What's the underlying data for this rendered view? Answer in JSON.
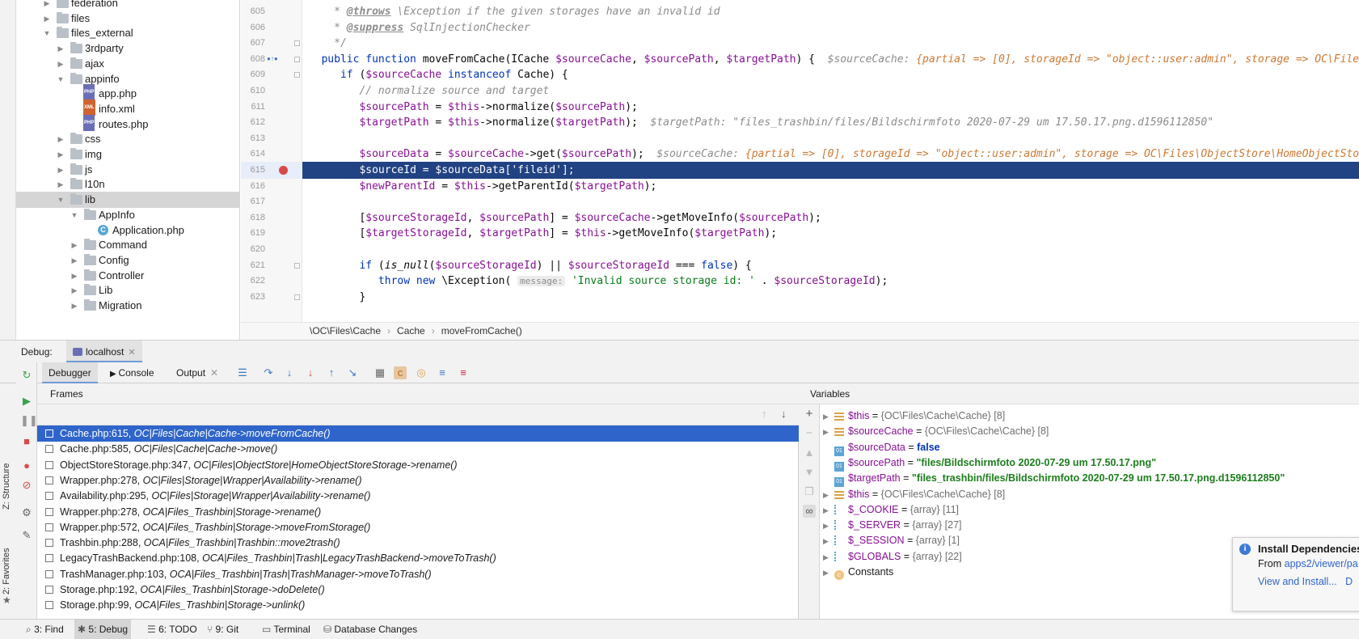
{
  "tree": {
    "items": [
      {
        "label": "federation",
        "type": "folder",
        "depth": 2,
        "expanded": false
      },
      {
        "label": "files",
        "type": "folder",
        "depth": 2,
        "expanded": false
      },
      {
        "label": "files_external",
        "type": "folder",
        "depth": 2,
        "expanded": true
      },
      {
        "label": "3rdparty",
        "type": "folder",
        "depth": 3,
        "expanded": false
      },
      {
        "label": "ajax",
        "type": "folder",
        "depth": 3,
        "expanded": false
      },
      {
        "label": "appinfo",
        "type": "folder",
        "depth": 3,
        "expanded": true
      },
      {
        "label": "app.php",
        "type": "php",
        "depth": 4
      },
      {
        "label": "info.xml",
        "type": "xml",
        "depth": 4
      },
      {
        "label": "routes.php",
        "type": "php",
        "depth": 4
      },
      {
        "label": "css",
        "type": "folder",
        "depth": 3,
        "expanded": false
      },
      {
        "label": "img",
        "type": "folder",
        "depth": 3,
        "expanded": false
      },
      {
        "label": "js",
        "type": "folder",
        "depth": 3,
        "expanded": false
      },
      {
        "label": "l10n",
        "type": "folder",
        "depth": 3,
        "expanded": false
      },
      {
        "label": "lib",
        "type": "folder",
        "depth": 3,
        "expanded": true,
        "selected": true
      },
      {
        "label": "AppInfo",
        "type": "folder",
        "depth": 4,
        "expanded": true
      },
      {
        "label": "Application.php",
        "type": "class",
        "depth": 5
      },
      {
        "label": "Command",
        "type": "folder",
        "depth": 4,
        "expanded": false
      },
      {
        "label": "Config",
        "type": "folder",
        "depth": 4,
        "expanded": false
      },
      {
        "label": "Controller",
        "type": "folder",
        "depth": 4,
        "expanded": false
      },
      {
        "label": "Lib",
        "type": "folder",
        "depth": 4,
        "expanded": false
      },
      {
        "label": "Migration",
        "type": "folder",
        "depth": 4,
        "expanded": false
      }
    ]
  },
  "editor": {
    "line_numbers": [
      "605",
      "606",
      "607",
      "608",
      "609",
      "610",
      "611",
      "612",
      "613",
      "614",
      "615",
      "616",
      "617",
      "618",
      "619",
      "620",
      "621",
      "622",
      "623"
    ],
    "current_line": "615",
    "breadcrumb": [
      "\\OC\\Files\\Cache",
      "Cache",
      "moveFromCache()"
    ]
  },
  "debug": {
    "title": "Debug:",
    "session_tab": "localhost",
    "tabs": [
      "Debugger",
      "Console",
      "Output"
    ],
    "frames_title": "Frames",
    "variables_title": "Variables",
    "frames": [
      {
        "file": "Cache.php:615,",
        "method": "OC|Files|Cache|Cache->moveFromCache()"
      },
      {
        "file": "Cache.php:585,",
        "method": "OC|Files|Cache|Cache->move()"
      },
      {
        "file": "ObjectStoreStorage.php:347,",
        "method": "OC|Files|ObjectStore|HomeObjectStoreStorage->rename()"
      },
      {
        "file": "Wrapper.php:278,",
        "method": "OC|Files|Storage|Wrapper|Availability->rename()"
      },
      {
        "file": "Availability.php:295,",
        "method": "OC|Files|Storage|Wrapper|Availability->rename()"
      },
      {
        "file": "Wrapper.php:278,",
        "method": "OCA|Files_Trashbin|Storage->rename()"
      },
      {
        "file": "Wrapper.php:572,",
        "method": "OCA|Files_Trashbin|Storage->moveFromStorage()"
      },
      {
        "file": "Trashbin.php:288,",
        "method": "OCA|Files_Trashbin|Trashbin::move2trash()"
      },
      {
        "file": "LegacyTrashBackend.php:108,",
        "method": "OCA|Files_Trashbin|Trash|LegacyTrashBackend->moveToTrash()"
      },
      {
        "file": "TrashManager.php:103,",
        "method": "OCA|Files_Trashbin|Trash|TrashManager->moveToTrash()"
      },
      {
        "file": "Storage.php:192,",
        "method": "OCA|Files_Trashbin|Storage->doDelete()"
      },
      {
        "file": "Storage.php:99,",
        "method": "OCA|Files_Trashbin|Storage->unlink()"
      }
    ],
    "variables": [
      {
        "name": "$this",
        "eq": " = ",
        "value": "{OC\\Files\\Cache\\Cache} [8]",
        "kind": "obj",
        "expandable": true
      },
      {
        "name": "$sourceCache",
        "eq": " = ",
        "value": "{OC\\Files\\Cache\\Cache} [8]",
        "kind": "obj",
        "expandable": true
      },
      {
        "name": "$sourceData",
        "eq": " = ",
        "value": "false",
        "kind": "kw",
        "expandable": false
      },
      {
        "name": "$sourcePath",
        "eq": " = ",
        "value": "\"files/Bildschirmfoto 2020-07-29 um 17.50.17.png\"",
        "kind": "str",
        "expandable": false
      },
      {
        "name": "$targetPath",
        "eq": " = ",
        "value": "\"files_trashbin/files/Bildschirmfoto 2020-07-29 um 17.50.17.png.d1596112850\"",
        "kind": "str",
        "expandable": false
      },
      {
        "name": "$this",
        "eq": " = ",
        "value": "{OC\\Files\\Cache\\Cache} [8]",
        "kind": "obj",
        "expandable": true
      },
      {
        "name": "$_COOKIE",
        "eq": " = ",
        "value": "{array} [11]",
        "kind": "arr",
        "expandable": true
      },
      {
        "name": "$_SERVER",
        "eq": " = ",
        "value": "{array} [27]",
        "kind": "arr",
        "expandable": true
      },
      {
        "name": "$_SESSION",
        "eq": " = ",
        "value": "{array} [1]",
        "kind": "arr",
        "expandable": true
      },
      {
        "name": "$GLOBALS",
        "eq": " = ",
        "value": "{array} [22]",
        "kind": "arr",
        "expandable": true
      },
      {
        "name": "Constants",
        "eq": "",
        "value": "",
        "kind": "const",
        "expandable": true
      }
    ]
  },
  "notification": {
    "title": "Install Dependencies",
    "from_label": "From",
    "from_link": "apps2/viewer/pa",
    "action": "View and Install...",
    "action2": "D"
  },
  "vertical_tools": [
    "Z: Structure",
    "2: Favorites"
  ],
  "statusbar": [
    {
      "label": "3: Find",
      "icon": "search-icon"
    },
    {
      "label": "5: Debug",
      "icon": "bug-icon",
      "active": true
    },
    {
      "label": "6: TODO",
      "icon": "list-icon"
    },
    {
      "label": "9: Git",
      "icon": "branch-icon"
    },
    {
      "label": "Terminal",
      "icon": "terminal-icon"
    },
    {
      "label": "Database Changes",
      "icon": "database-icon"
    }
  ],
  "colors": {
    "selection": "#2f65ca",
    "exec_line": "#214283",
    "keyword": "#0033b3",
    "variable": "#871094",
    "string": "#067d17"
  }
}
